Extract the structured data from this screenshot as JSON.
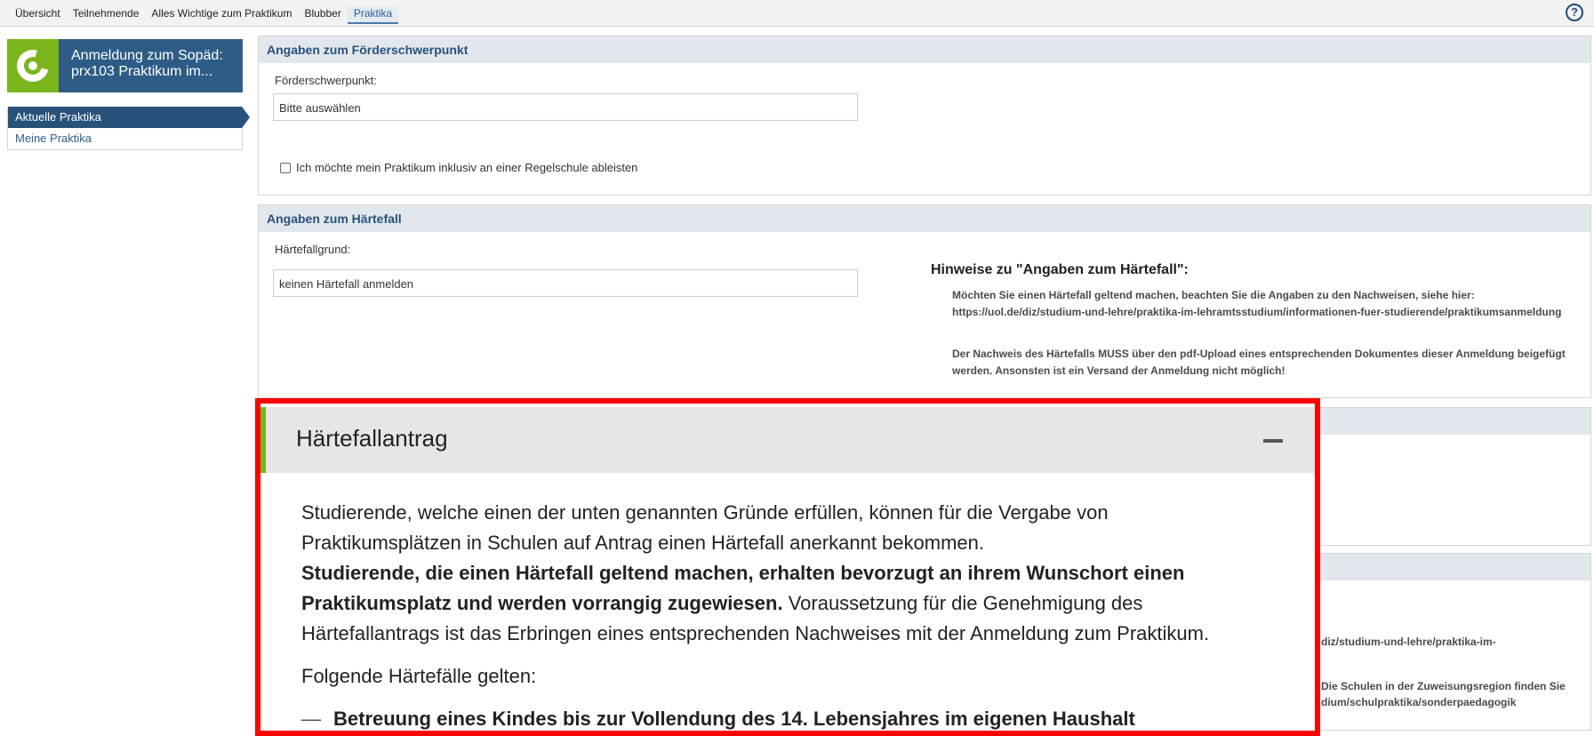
{
  "tabs": [
    "Übersicht",
    "Teilnehmende",
    "Alles Wichtige zum Praktikum",
    "Blubber",
    "Praktika"
  ],
  "help": "?",
  "sidebar": {
    "title_line1": "Anmeldung zum Sopäd:",
    "title_line2": "prx103 Praktikum im...",
    "items": [
      "Aktuelle Praktika",
      "Meine Praktika"
    ]
  },
  "foerder": {
    "heading": "Angaben zum Förderschwerpunkt",
    "label": "Förderschwerpunkt:",
    "select_value": "Bitte auswählen",
    "checkbox_label": "Ich möchte mein Praktikum inklusiv an einer Regelschule ableisten"
  },
  "haerte": {
    "heading": "Angaben zum Härtefall",
    "label": "Härtefallgrund:",
    "select_value": "keinen Härtefall anmelden",
    "hint_title": "Hinweise zu \"Angaben zum Härtefall\":",
    "hint_p1": "Möchten Sie einen Härtefall geltend machen, beachten Sie die Angaben zu den Nachweisen, siehe hier: https://uol.de/diz/studium-und-lehre/praktika-im-lehramtsstudium/informationen-fuer-studierende/praktikumsanmeldung",
    "hint_p2": "Der Nachweis des Härtefalls MUSS über den pdf-Upload eines entsprechenden Dokumentes dieser Anmeldung beigefügt werden. Ansonsten ist ein Versand der Anmeldung nicht möglich!"
  },
  "background_fragments": {
    "line1": "diz/studium-und-lehre/praktika-im-",
    "line2": "Die Schulen in der Zuweisungsregion finden Sie",
    "line3": "dium/schulpraktika/sonderpaedagogik"
  },
  "overlay": {
    "title": "Härtefallantrag",
    "para1_a": "Studierende, welche einen der unten genannten Gründe erfüllen, können für die Vergabe von Praktikumsplätzen in Schulen auf Antrag einen Härtefall anerkannt bekommen.",
    "para1_bold": "Studierende, die einen Härtefall geltend machen, erhalten bevorzugt an ihrem Wunschort einen Praktikumsplatz und werden vorrangig zugewiesen.",
    "para1_b": " Voraussetzung für die Genehmigung des Härtefallantrags ist das Erbringen eines entsprechenden Nachweises mit der Anmeldung zum Praktikum.",
    "para2": "Folgende Härtefälle gelten:",
    "list_dash": "—",
    "list_item1": "Betreuung eines Kindes bis zur Vollendung des 14. Lebensjahres im eigenen Haushalt"
  }
}
